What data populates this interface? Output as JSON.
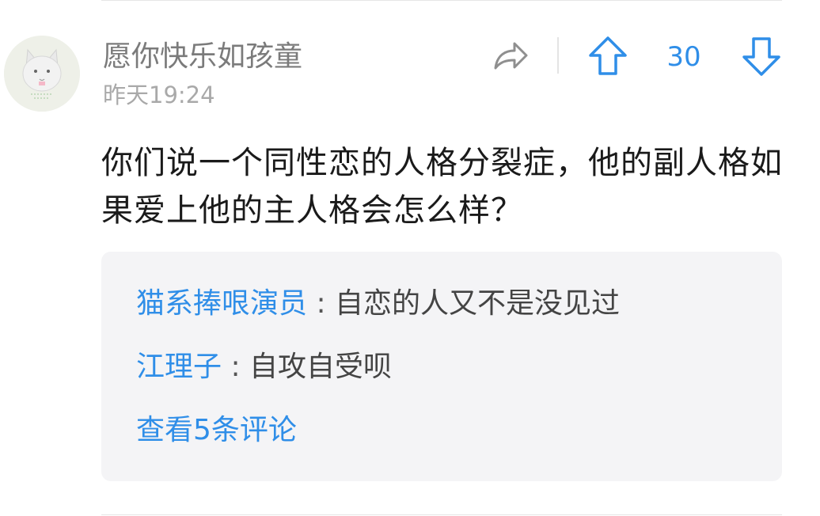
{
  "post": {
    "username": "愿你快乐如孩童",
    "timestamp": "昨天19:24",
    "avatar": "cat-avatar",
    "content": "你们说一个同性恋的人格分裂症，他的副人格如果爱上他的主人格会怎么样？",
    "vote_count": "30"
  },
  "actions": {
    "share_icon": "share-arrow-icon",
    "upvote_icon": "arrow-up-icon",
    "downvote_icon": "arrow-down-icon"
  },
  "replies": [
    {
      "user": "猫系捧哏演员",
      "separator": " : ",
      "text": "自恋的人又不是没见过"
    },
    {
      "user": "江理子",
      "separator": " : ",
      "text": "自攻自受呗"
    }
  ],
  "view_more": "查看5条评论",
  "colors": {
    "accent": "#2f8ee8",
    "username": "#7b7b7b",
    "timestamp": "#a9a9a9",
    "reply_bg": "#f4f4f6"
  }
}
